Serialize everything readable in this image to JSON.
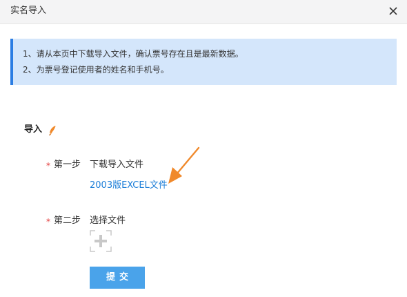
{
  "dialog": {
    "title": "实名导入",
    "close_icon": "close-icon"
  },
  "notice": {
    "lines": [
      "1、请从本页中下载导入文件，确认票号存在且是最新数据。",
      "2、为票号登记使用者的姓名和手机号。"
    ],
    "accent_color": "#2b7de3",
    "background_color": "#d4e6fb"
  },
  "import_section": {
    "title": "导入",
    "title_icon": "leaf-icon",
    "step1": {
      "required_mark": "*",
      "label": "第一步",
      "text": "下载导入文件",
      "link": "2003版EXCEL文件"
    },
    "step2": {
      "required_mark": "*",
      "label": "第二步",
      "text": "选择文件",
      "upload_icon": "plus-icon"
    },
    "submit_label": "提交",
    "link_color": "#1e7fd8",
    "button_color": "#4aa3ea",
    "annotation_arrow_color": "#f0892b"
  }
}
